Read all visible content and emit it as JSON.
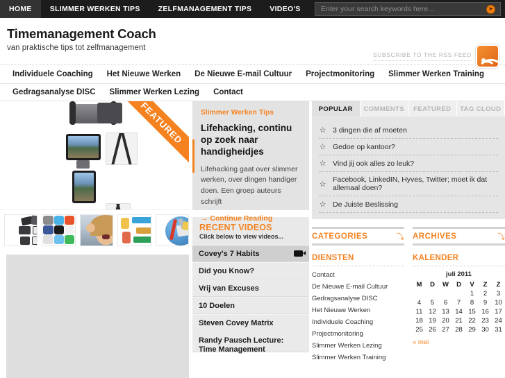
{
  "topbar": {
    "nav": [
      {
        "label": "HOME",
        "active": true
      },
      {
        "label": "SLIMMER WERKEN TIPS",
        "active": false
      },
      {
        "label": "ZELFMANAGEMENT TIPS",
        "active": false
      },
      {
        "label": "VIDEO'S",
        "active": false
      }
    ],
    "search": {
      "placeholder": "Enter your search keywords here...",
      "value": "",
      "button_icon": "arrow-right-circle-icon"
    }
  },
  "masthead": {
    "title": "Timemanagement Coach",
    "tagline": "van praktische tips tot zelfmanagement",
    "rss_text": "SUBSCRIBE TO THE RSS FEED",
    "rss_icon": "rss-icon"
  },
  "mainnav": [
    {
      "label": "Individuele Coaching"
    },
    {
      "label": "Het Nieuwe Werken"
    },
    {
      "label": "De Nieuwe E-mail Cultuur"
    },
    {
      "label": "Projectmonitoring"
    },
    {
      "label": "Slimmer Werken Training"
    }
  ],
  "subnav": [
    {
      "label": "Gedragsanalyse DISC"
    },
    {
      "label": "Slimmer Werken Lezing"
    },
    {
      "label": "Contact"
    }
  ],
  "slider": {
    "ribbon": "FEATURED",
    "thumb_count": 5
  },
  "feature": {
    "kicker": "Slimmer Werken Tips",
    "title": "Lifehacking, continu op zoek naar handigheidjes",
    "desc": "Lifehacking gaat over slimmer werken, over dingen handiger doen. Een groep auteurs schrijft",
    "more": "→ Continue Reading"
  },
  "videos": {
    "title": "RECENT VIDEOS",
    "subtitle": "Click below to view videos...",
    "items": [
      {
        "label": "Covey's 7 Habits",
        "selected": true,
        "icon": "video-camera-icon"
      },
      {
        "label": "Did you Know?",
        "selected": false
      },
      {
        "label": "Vrij van Excuses",
        "selected": false
      },
      {
        "label": "10 Doelen",
        "selected": false
      },
      {
        "label": "Steven Covey Matrix",
        "selected": false
      },
      {
        "label": "Randy Pausch Lecture: Time Management",
        "selected": false
      }
    ]
  },
  "tabs": [
    {
      "label": "POPULAR",
      "active": true
    },
    {
      "label": "COMMENTS",
      "active": false
    },
    {
      "label": "FEATURED",
      "active": false
    },
    {
      "label": "TAG CLOUD",
      "active": false
    }
  ],
  "popular": [
    {
      "label": "3 dingen die af moeten"
    },
    {
      "label": "Gedoe op kantoor?"
    },
    {
      "label": "Vind jij ook alles zo leuk?"
    },
    {
      "label": "Facebook, LinkedIN, Hyves, Twitter; moet ik dat allemaal doen?"
    },
    {
      "label": "De Juiste Beslissing"
    }
  ],
  "widgets": {
    "categories": {
      "head": "CATEGORIES",
      "arrow": "⤵",
      "sub": "DIENSTEN",
      "links": [
        "Contact",
        "De Nieuwe E-mail Cultuur",
        "Gedragsanalyse DISC",
        "Het Nieuwe Werken",
        "Individuele Coaching",
        "Projectmonitoring",
        "Slimmer Werken Lezing",
        "Slimmer Werken Training"
      ]
    },
    "archives": {
      "head": "ARCHIVES",
      "arrow": "⤵",
      "sub": "KALENDER"
    }
  },
  "calendar": {
    "month": "juli 2011",
    "daynames": [
      "M",
      "D",
      "W",
      "D",
      "V",
      "Z",
      "Z"
    ],
    "weeks": [
      [
        "",
        "",
        "",
        "",
        "1",
        "2",
        "3"
      ],
      [
        "4",
        "5",
        "6",
        "7",
        "8",
        "9",
        "10"
      ],
      [
        "11",
        "12",
        "13",
        "14",
        "15",
        "16",
        "17"
      ],
      [
        "18",
        "19",
        "20",
        "21",
        "22",
        "23",
        "24"
      ],
      [
        "25",
        "26",
        "27",
        "28",
        "29",
        "30",
        "31"
      ]
    ],
    "prev": "« mei"
  },
  "colors": {
    "accent": "#f5821f",
    "topbar": "#1c1c1c",
    "panel": "#e5e5e5"
  }
}
